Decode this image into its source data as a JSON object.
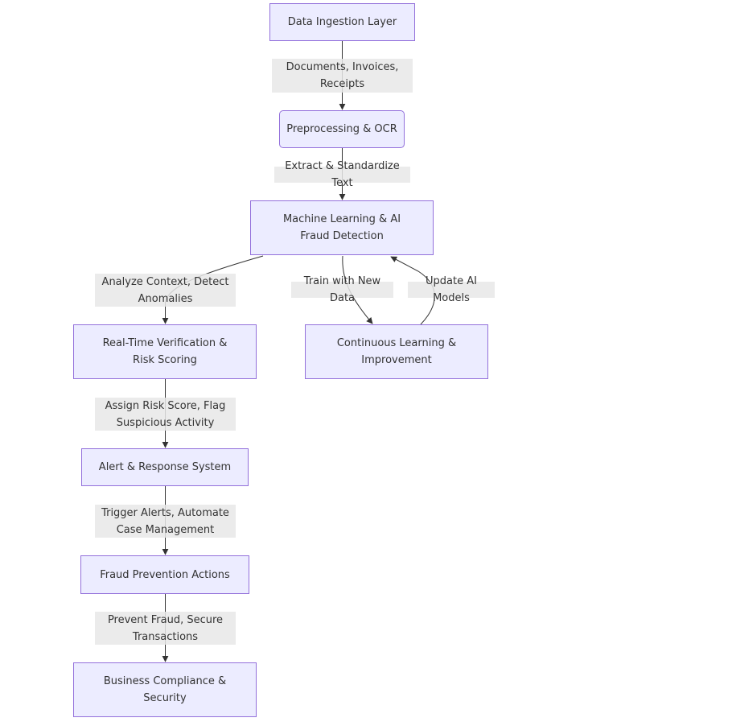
{
  "diagram": {
    "type": "flowchart",
    "direction": "top-down",
    "colors": {
      "node_fill": "#ECECFF",
      "node_border": "#9370DB",
      "edge": "#333333",
      "label_bg": "#E8E8E8",
      "text": "#333333"
    },
    "nodes": {
      "ingestion": "Data Ingestion Layer",
      "preprocessing": "Preprocessing & OCR",
      "ml": "Machine Learning & AI\nFraud Detection",
      "verification": "Real-Time Verification &\nRisk Scoring",
      "learning": "Continuous Learning &\nImprovement",
      "alert": "Alert & Response System",
      "prevention": "Fraud Prevention Actions",
      "compliance": "Business Compliance &\nSecurity"
    },
    "edges": {
      "ingestion_to_preprocessing": "Documents, Invoices,\nReceipts",
      "preprocessing_to_ml": "Extract & Standardize Text",
      "ml_to_verification": "Analyze Context, Detect\nAnomalies",
      "ml_to_learning": "Train with New Data",
      "learning_to_ml": "Update AI Models",
      "verification_to_alert": "Assign Risk Score, Flag\nSuspicious Activity",
      "alert_to_prevention": "Trigger Alerts, Automate\nCase Management",
      "prevention_to_compliance": "Prevent Fraud, Secure\nTransactions"
    }
  }
}
